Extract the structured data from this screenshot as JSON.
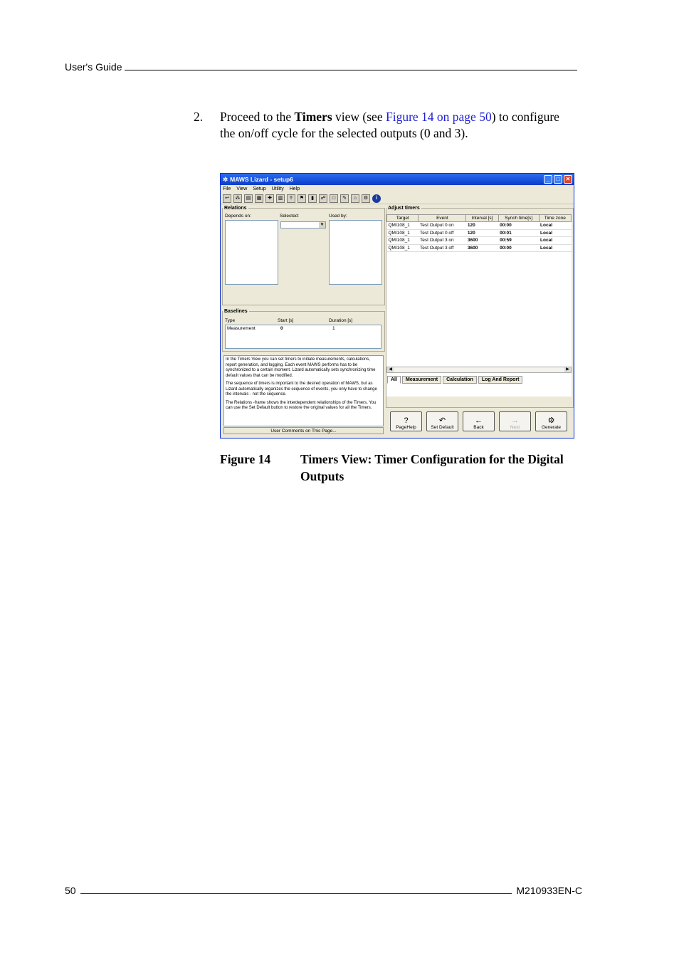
{
  "header": {
    "left": "User's Guide"
  },
  "footer": {
    "page": "50",
    "doc_id": "M210933EN-C"
  },
  "step": {
    "number": "2.",
    "pre": "Proceed to the ",
    "bold": "Timers",
    "mid": " view (see ",
    "link": "Figure 14 on page 50",
    "post": ") to configure the on/off cycle for the selected outputs (0 and 3)."
  },
  "caption": {
    "label": "Figure 14",
    "title": "Timers View: Timer Configuration for the Digital Outputs"
  },
  "window": {
    "title": "MAWS Lizard - setup6",
    "menu": [
      "File",
      "View",
      "Setup",
      "Utility",
      "Help"
    ],
    "relations": {
      "legend": "Relations",
      "depends_on": "Depends on:",
      "selected": "Selected:",
      "used_by": "Used by:"
    },
    "baselines": {
      "legend": "Baselines",
      "headers": [
        "Type",
        "Start [s]",
        "Duration [s]"
      ],
      "row": [
        "Measurement",
        "0",
        "1"
      ]
    },
    "description": [
      "In the Timers View you can set timers to initiate measurements, calculations, report generation, and logging. Each event MAWS performs has to be synchronized to a certain moment. Lizard automatically sets synchronizing time default values that can be modified.",
      "The sequence of timers is important to the desired operation of MAWS, but as Lizard automatically organizes the sequence of events, you only have to change the intervals - not the sequence.",
      "The Relations -frame shows the interdependent relationships of the Timers. You can use the Set Default button to restore the original values for all the Timers."
    ],
    "comments": "User Comments on This Page...",
    "adjust": {
      "legend": "Adjust timers",
      "headers": [
        "Target",
        "Event",
        "Interval [s]",
        "Synch time[s]",
        "Time zone"
      ],
      "rows": [
        [
          "QMI108_1",
          "Test Output 0 on",
          "120",
          "00:00",
          "Local"
        ],
        [
          "QMI108_1",
          "Test Output 0 off",
          "120",
          "00:01",
          "Local"
        ],
        [
          "QMI108_1",
          "Test Output 3 on",
          "3600",
          "00:59",
          "Local"
        ],
        [
          "QMI108_1",
          "Test Output 3 off",
          "3600",
          "00:00",
          "Local"
        ]
      ]
    },
    "tabs": [
      "All",
      "Measurement",
      "Calculation",
      "Log And Report"
    ],
    "buttons": {
      "pagehelp": "PageHelp",
      "setdefault": "Set Default",
      "back": "Back",
      "next": "Next",
      "generate": "Generate"
    }
  }
}
